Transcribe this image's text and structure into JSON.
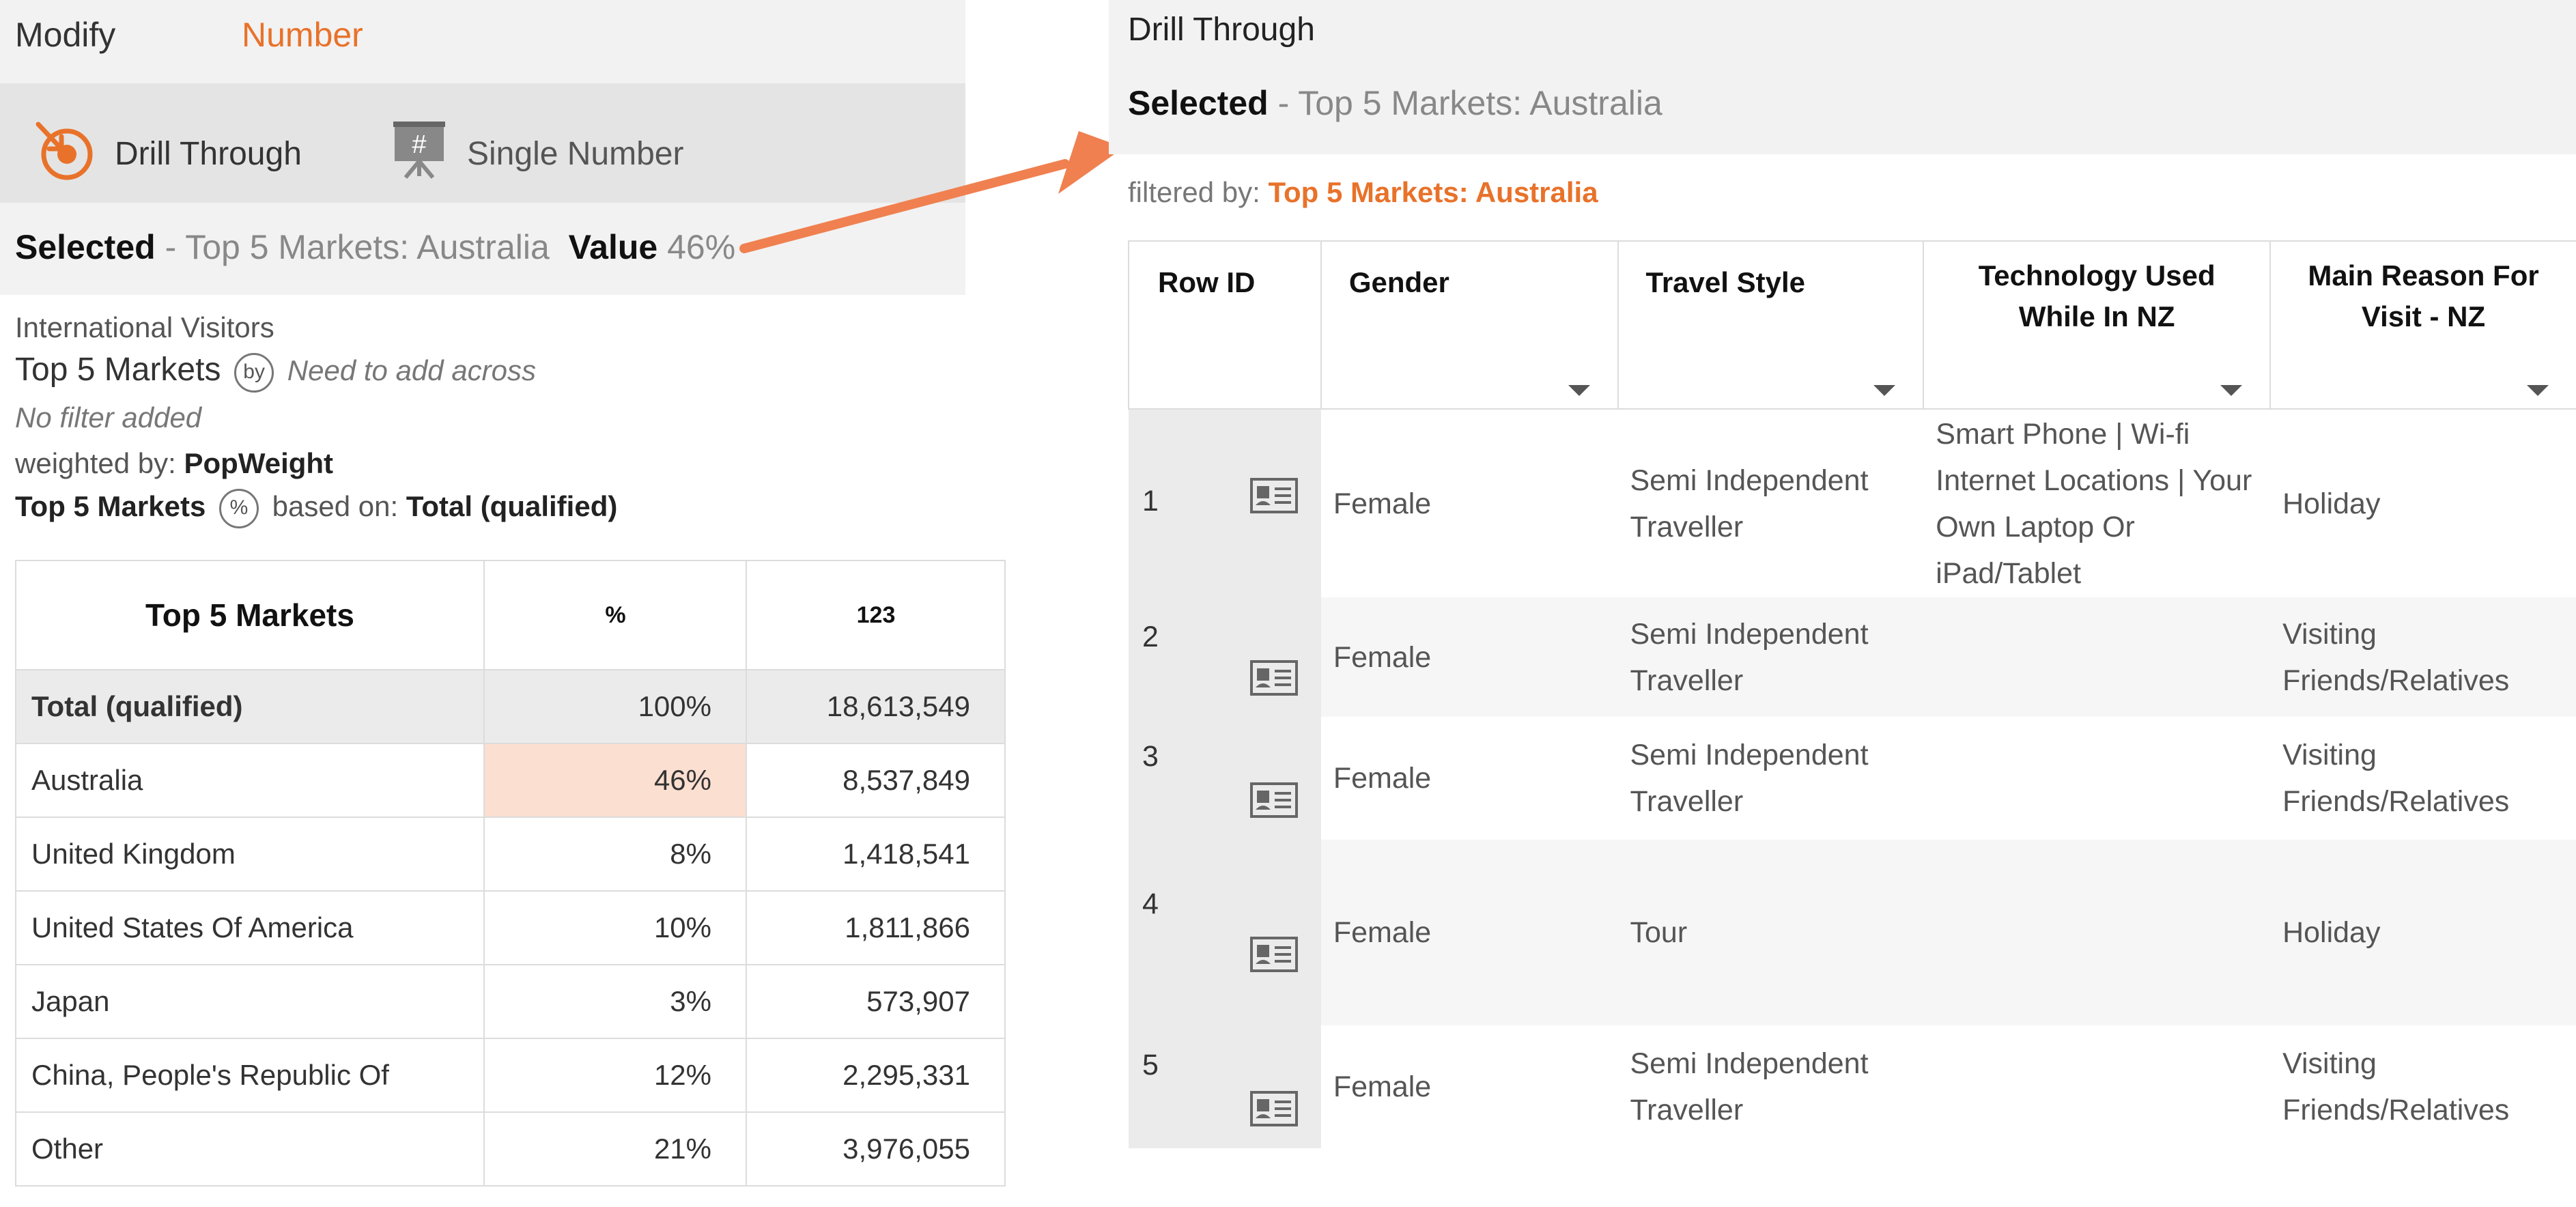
{
  "tabs": {
    "modify": "Modify",
    "number": "Number"
  },
  "toolbar": {
    "drill": "Drill Through",
    "single": "Single Number",
    "single_icon_glyph": "#"
  },
  "selection": {
    "selected_label": "Selected",
    "selected_value": " - Top 5 Markets: Australia",
    "value_label": "Value",
    "value": "46%"
  },
  "info": {
    "dataset": "International Visitors",
    "row_var": "Top 5 Markets",
    "by_badge": "by",
    "across_note": "Need to add across",
    "filter_note": "No filter added",
    "weighted_label": "weighted by:",
    "weight_value": "PopWeight",
    "pct_var": "Top 5 Markets",
    "pct_badge": "%",
    "based_label": "based on:",
    "based_value": "Total (qualified)"
  },
  "crosstab": {
    "headers": [
      "Top 5 Markets",
      "%",
      "123"
    ],
    "rows": [
      [
        "Total (qualified)",
        "100%",
        "18,613,549"
      ],
      [
        "Australia",
        "46%",
        "8,537,849"
      ],
      [
        "United Kingdom",
        "8%",
        "1,418,541"
      ],
      [
        "United States Of America",
        "10%",
        "1,811,866"
      ],
      [
        "Japan",
        "3%",
        "573,907"
      ],
      [
        "China, People's Republic Of",
        "12%",
        "2,295,331"
      ],
      [
        "Other",
        "21%",
        "3,976,055"
      ]
    ]
  },
  "drill": {
    "title": "Drill Through",
    "selected_label": "Selected",
    "selected_value": " - Top 5 Markets: Australia",
    "filtered_label": "filtered by:",
    "filtered_value": "Top 5 Markets: Australia",
    "headers": [
      "Row ID",
      "Gender",
      "Travel Style",
      "Technology Used While In NZ",
      "Main Reason For Visit - NZ"
    ],
    "rows": [
      [
        "1",
        "Female",
        "Semi Independent Traveller",
        "Smart Phone | Wi-fi Internet Locations | Your Own Laptop Or iPad/Tablet",
        "Holiday"
      ],
      [
        "2",
        "Female",
        "Semi Independent Traveller",
        "",
        "Visiting Friends/Relatives"
      ],
      [
        "3",
        "Female",
        "Semi Independent Traveller",
        "",
        "Visiting Friends/Relatives"
      ],
      [
        "4",
        "Female",
        "Tour",
        "",
        "Holiday"
      ],
      [
        "5",
        "Female",
        "Semi Independent Traveller",
        "",
        "Visiting Friends/Relatives"
      ]
    ]
  },
  "colors": {
    "accent": "#e8722a",
    "highlight": "#fbdfd0",
    "arrow": "#f08050"
  }
}
